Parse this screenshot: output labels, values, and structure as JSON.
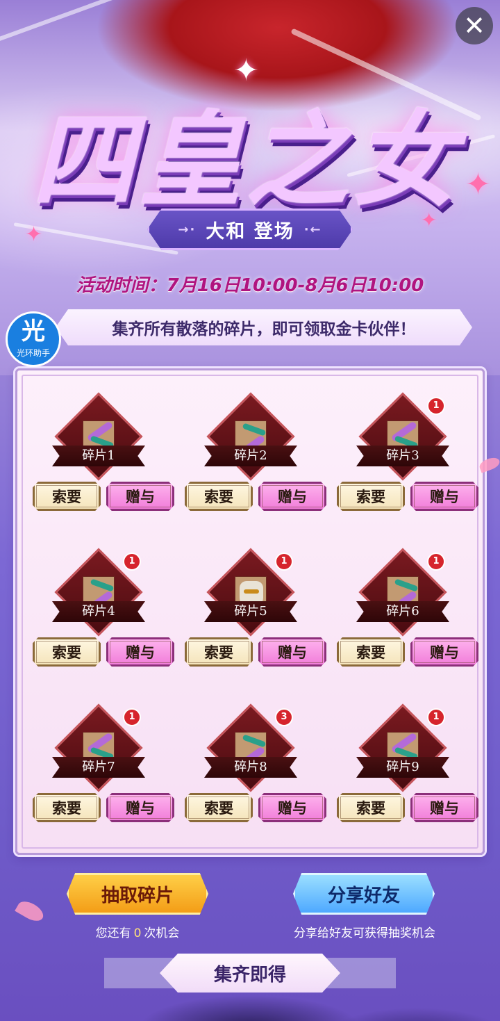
{
  "header": {
    "title": "四皇之女",
    "subtitle": "大和 登场",
    "subtitle_deco_left": "→·",
    "subtitle_deco_right": "·←",
    "event_time": "活动时间：7月16日10:00-8月6日10:00",
    "close_glyph": "✕"
  },
  "helper": {
    "glyph": "光",
    "label": "光环助手"
  },
  "notice": "集齐所有散落的碎片，即可领取金卡伙伴！",
  "fragments": [
    {
      "label": "碎片1",
      "badge": "",
      "art": "swirl",
      "ask": "索要",
      "give": "赠与"
    },
    {
      "label": "碎片2",
      "badge": "",
      "art": "hair",
      "ask": "索要",
      "give": "赠与"
    },
    {
      "label": "碎片3",
      "badge": "1",
      "art": "swirl",
      "ask": "索要",
      "give": "赠与"
    },
    {
      "label": "碎片4",
      "badge": "1",
      "art": "hair",
      "ask": "索要",
      "give": "赠与"
    },
    {
      "label": "碎片5",
      "badge": "1",
      "art": "mask",
      "ask": "索要",
      "give": "赠与"
    },
    {
      "label": "碎片6",
      "badge": "1",
      "art": "hair",
      "ask": "索要",
      "give": "赠与"
    },
    {
      "label": "碎片7",
      "badge": "1",
      "art": "swirl",
      "ask": "索要",
      "give": "赠与"
    },
    {
      "label": "碎片8",
      "badge": "3",
      "art": "hair",
      "ask": "索要",
      "give": "赠与"
    },
    {
      "label": "碎片9",
      "badge": "1",
      "art": "swirl",
      "ask": "索要",
      "give": "赠与"
    }
  ],
  "actions": {
    "draw_label": "抽取碎片",
    "share_label": "分享好友",
    "draw_hint_prefix": "您还有",
    "draw_hint_count": "0",
    "draw_hint_suffix": "次机会",
    "share_hint": "分享给好友可获得抽奖机会"
  },
  "collect": "集齐即得",
  "colors": {
    "accent_magenta": "#b0147f",
    "badge_red": "#d6242c",
    "draw_gold": "#f39a14",
    "share_blue": "#4aa6ff"
  }
}
